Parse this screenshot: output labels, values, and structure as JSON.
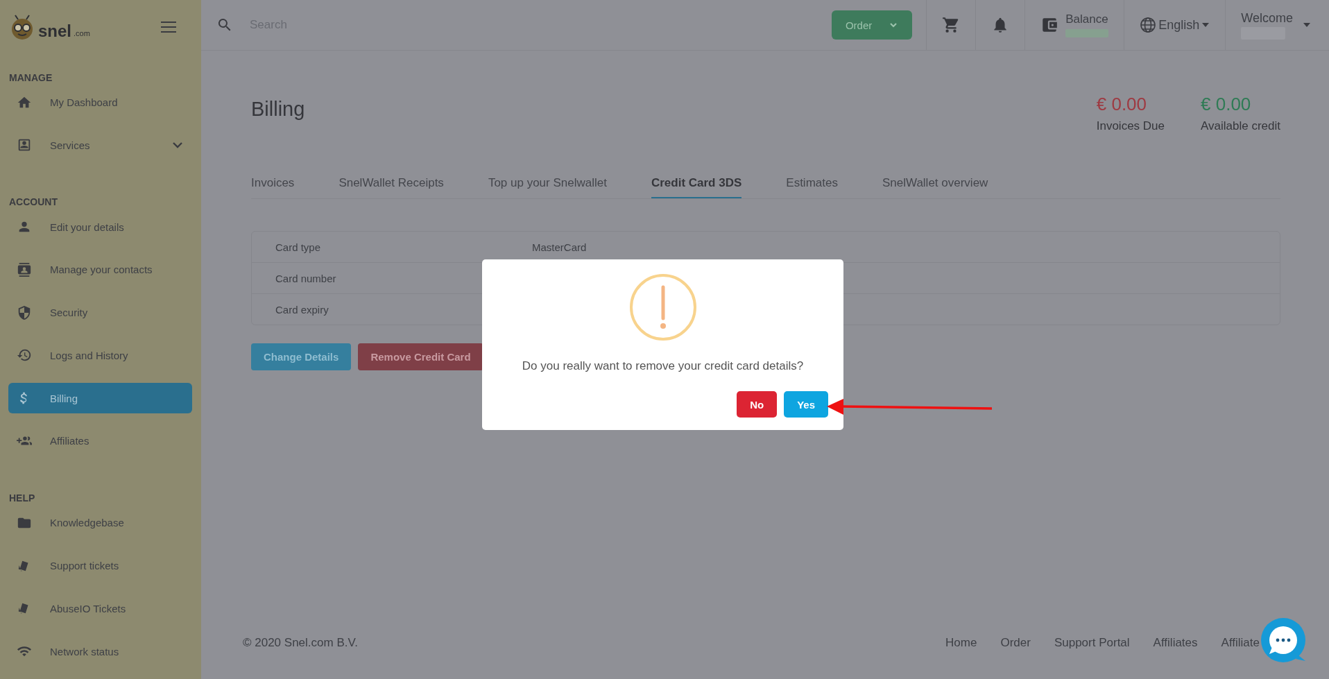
{
  "sidebar": {
    "logo": {
      "name": "snel",
      "suffix": ".com"
    },
    "sections": [
      {
        "title": "MANAGE",
        "items": [
          {
            "label": "My Dashboard",
            "kind": "home",
            "selected": false,
            "has_submenu": false
          },
          {
            "label": "Services",
            "kind": "id-card",
            "selected": false,
            "has_submenu": true
          }
        ]
      },
      {
        "title": "ACCOUNT",
        "items": [
          {
            "label": "Edit your details",
            "kind": "person",
            "selected": false,
            "has_submenu": false
          },
          {
            "label": "Manage your contacts",
            "kind": "contacts",
            "selected": false,
            "has_submenu": false
          },
          {
            "label": "Security",
            "kind": "shield",
            "selected": false,
            "has_submenu": false
          },
          {
            "label": "Logs and History",
            "kind": "history",
            "selected": false,
            "has_submenu": false
          },
          {
            "label": "Billing",
            "kind": "dollar",
            "selected": true,
            "has_submenu": false
          },
          {
            "label": "Affiliates",
            "kind": "group-add",
            "selected": false,
            "has_submenu": false
          }
        ]
      },
      {
        "title": "HELP",
        "items": [
          {
            "label": "Knowledgebase",
            "kind": "folder",
            "selected": false,
            "has_submenu": false
          },
          {
            "label": "Support tickets",
            "kind": "tickets",
            "selected": false,
            "has_submenu": false
          },
          {
            "label": "AbuseIO Tickets",
            "kind": "tickets",
            "selected": false,
            "has_submenu": false
          },
          {
            "label": "Network status",
            "kind": "wifi",
            "selected": false,
            "has_submenu": false
          }
        ]
      }
    ]
  },
  "topbar": {
    "search": {
      "placeholder": "Search"
    },
    "order_button": "Order",
    "balance_label": "Balance",
    "language": "English",
    "welcome": "Welcome"
  },
  "page": {
    "title": "Billing",
    "summaries": [
      {
        "amount": "€ 0.00",
        "label": "Invoices Due",
        "color": "#9e3a42"
      },
      {
        "amount": "€ 0.00",
        "label": "Available credit",
        "color": "#2f7b55"
      }
    ],
    "tabs": [
      {
        "label": "Invoices",
        "selected": false
      },
      {
        "label": "SnelWallet Receipts",
        "selected": false
      },
      {
        "label": "Top up your Snelwallet",
        "selected": false
      },
      {
        "label": "Credit Card 3DS",
        "selected": true
      },
      {
        "label": "Estimates",
        "selected": false
      },
      {
        "label": "SnelWallet overview",
        "selected": false
      }
    ],
    "card_details": [
      {
        "label": "Card type",
        "value": "MasterCard"
      },
      {
        "label": "Card number"
      },
      {
        "label": "Card expiry"
      }
    ],
    "buttons": [
      {
        "label": "Change Details",
        "kind": "primary"
      },
      {
        "label": "Remove Credit Card",
        "kind": "danger"
      }
    ]
  },
  "footer": {
    "copyright": "© 2020 Snel.com B.V.",
    "links": [
      "Home",
      "Order",
      "Support Portal",
      "Affiliates",
      "Affiliate"
    ]
  },
  "dialog": {
    "message": "Do you really want to remove your credit card details?",
    "buttons": [
      {
        "label": "No",
        "kind": "danger"
      },
      {
        "label": "Yes",
        "kind": "confirm"
      }
    ]
  }
}
